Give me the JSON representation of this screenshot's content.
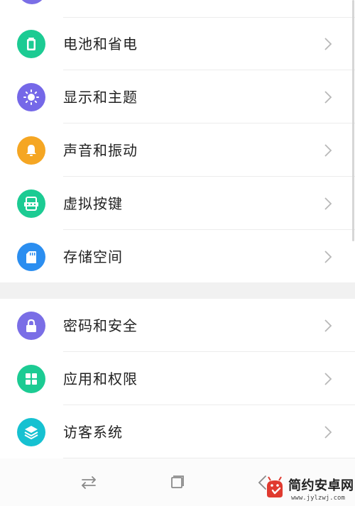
{
  "colors": {
    "partial": "#7a6ee6",
    "battery": "#1ccb93",
    "display": "#7568e8",
    "sound": "#f5a623",
    "virtual_keys": "#1ccb93",
    "storage": "#2b8ef0",
    "password": "#7a6ee6",
    "apps": "#1ccb93",
    "guest": "#16c1d1",
    "chevron": "#b8b8b8",
    "separator": "#f1f1f1"
  },
  "settings": {
    "group1": [
      {
        "id": "battery",
        "label": "电池和省电",
        "icon": "battery-icon"
      },
      {
        "id": "display",
        "label": "显示和主题",
        "icon": "brightness-icon"
      },
      {
        "id": "sound",
        "label": "声音和振动",
        "icon": "bell-icon"
      },
      {
        "id": "virtual_keys",
        "label": "虚拟按键",
        "icon": "virtual-keys-icon"
      },
      {
        "id": "storage",
        "label": "存储空间",
        "icon": "sd-card-icon"
      }
    ],
    "group2": [
      {
        "id": "password",
        "label": "密码和安全",
        "icon": "lock-icon"
      },
      {
        "id": "apps",
        "label": "应用和权限",
        "icon": "app-grid-icon"
      },
      {
        "id": "guest",
        "label": "访客系统",
        "icon": "layers-icon"
      }
    ]
  },
  "navbar": {
    "buttons": [
      "switch-icon",
      "recent-apps-icon",
      "back-icon"
    ]
  },
  "watermark": {
    "title": "简约安卓网",
    "url": "www.jylzwj.com"
  }
}
